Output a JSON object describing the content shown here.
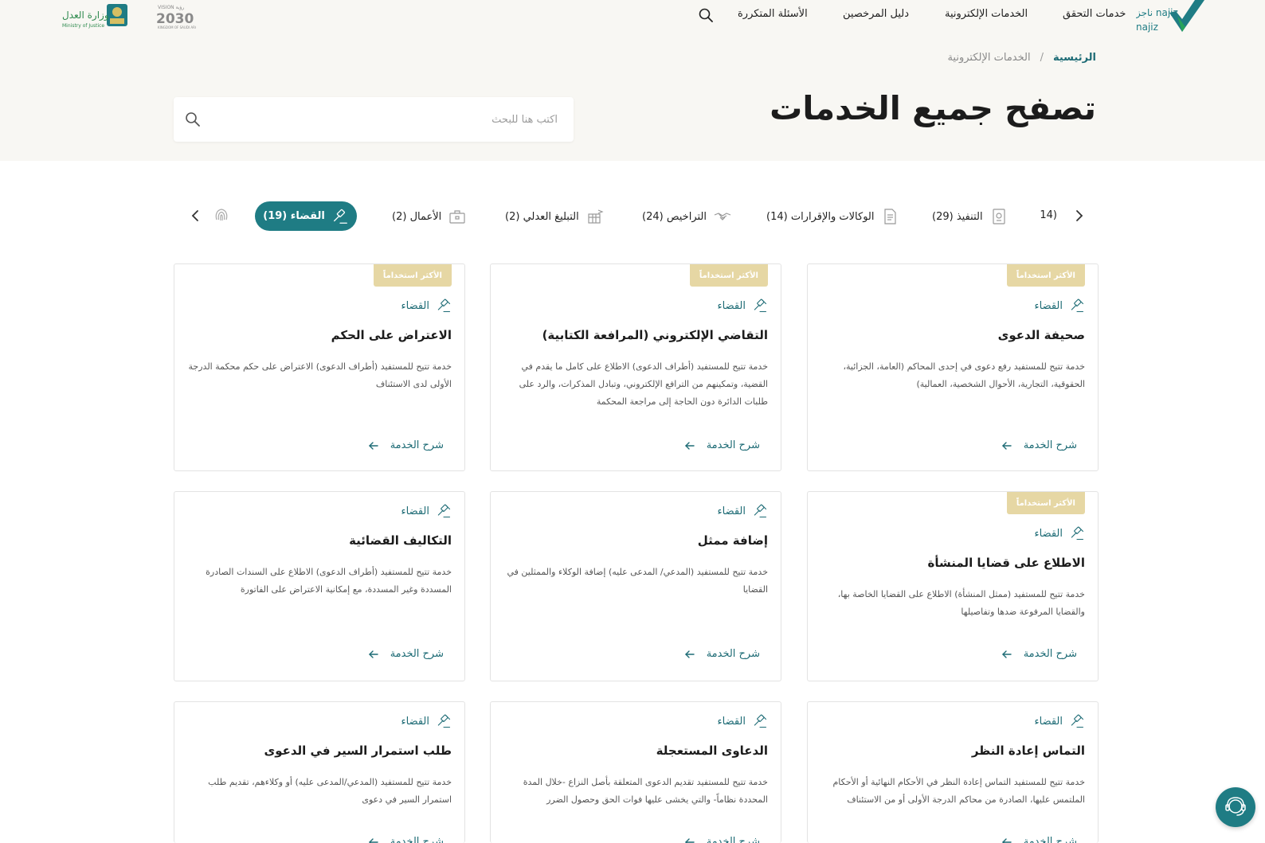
{
  "header": {
    "logo_text": "ناجز najiz",
    "nav": [
      "خدمات التحقق",
      "الخدمات الإلكترونية",
      "دليل المرخصين",
      "الأسئلة المتكررة"
    ],
    "search_icon": "search-icon",
    "vision_logo_text": "VISION 2030",
    "ministry_logo_text": "وزارة العدل Ministry of Justice"
  },
  "breadcrumb": {
    "home": "الرئيسية",
    "separator": "/",
    "current": "الخدمات الإلكترونية"
  },
  "page_title": "تصفح جميع الخدمات",
  "search": {
    "placeholder": "اكتب هنا للبحث",
    "value": ""
  },
  "categories": {
    "partial": "(14",
    "items": [
      {
        "label": "التنفيذ (29)",
        "icon": "execution-icon"
      },
      {
        "label": "الوكالات والإقرارات (14)",
        "icon": "document-icon"
      },
      {
        "label": "التراخيص (24)",
        "icon": "handshake-icon"
      },
      {
        "label": "التبليغ العدلي (2)",
        "icon": "notification-building-icon"
      },
      {
        "label": "الأعمال (2)",
        "icon": "briefcase-icon"
      }
    ],
    "active": {
      "label": "القضاء (19)",
      "icon": "gavel-icon"
    },
    "extra_icon": "fingerprint-icon"
  },
  "cards": [
    {
      "badge": "الأكثر استخداماً",
      "category": "القضاء",
      "title": "صحيفة الدعوى",
      "desc": "خدمة تتيح للمستفيد رفع دعوى في إحدى المحاكم (العامة، الجزائية، الحقوقية، التجارية، الأحوال الشخصية، العمالية)",
      "link": "شرح الخدمة"
    },
    {
      "badge": "الأكثر استخداماً",
      "category": "القضاء",
      "title": "التقاضي الإلكتروني (المرافعة الكتابية)",
      "desc": "خدمة تتيح للمستفيد (أطراف الدعوى) الاطلاع على كامل ما يقدم في القضية، وتمكينهم من الترافع الإلكتروني، وتبادل المذكرات، والرد على طلبات الدائرة دون الحاجة إلى مراجعة المحكمة",
      "link": "شرح الخدمة"
    },
    {
      "badge": "الأكثر استخداماً",
      "category": "القضاء",
      "title": "الاعتراض على الحكم",
      "desc": "خدمة تتيح للمستفيد (أطراف الدعوى) الاعتراض على حكم محكمة الدرجة الأولى لدى الاستئناف",
      "link": "شرح الخدمة"
    },
    {
      "badge": "الأكثر استخداماً",
      "category": "القضاء",
      "title": "الاطلاع على قضايا المنشأة",
      "desc": "خدمة تتيح للمستفيد (ممثل المنشأة) الاطلاع على القضايا الخاصة بها، والقضايا المرفوعة ضدها وتفاصيلها",
      "link": "شرح الخدمة"
    },
    {
      "badge": "",
      "category": "القضاء",
      "title": "إضافة ممثل",
      "desc": "خدمة تتيح للمستفيد (المدعي/ المدعى عليه) إضافة الوكلاء والممثلين في القضايا",
      "link": "شرح الخدمة"
    },
    {
      "badge": "",
      "category": "القضاء",
      "title": "التكاليف القضائية",
      "desc": "خدمة تتيح للمستفيد (أطراف الدعوى) الاطلاع على السندات الصادرة المسددة وغير المسددة، مع إمكانية الاعتراض على الفاتورة",
      "link": "شرح الخدمة"
    },
    {
      "badge": "",
      "category": "القضاء",
      "title": "التماس إعادة النظر",
      "desc": "خدمة تتيح للمستفيد التماس إعادة النظر في الأحكام النهائية أو الأحكام الملتمس عليها، الصادرة من محاكم الدرجة الأولى أو من الاستئناف",
      "link": "شرح الخدمة"
    },
    {
      "badge": "",
      "category": "القضاء",
      "title": "الدعاوى المستعجلة",
      "desc": "خدمة تتيح للمستفيد تقديم الدعوى المتعلقة بأصل النزاع -خلال المدة المحددة نظاماً- والتي يخشى عليها فوات الحق وحصول الضرر",
      "link": "شرح الخدمة"
    },
    {
      "badge": "",
      "category": "القضاء",
      "title": "طلب استمرار السير في الدعوى",
      "desc": "خدمة تتيح للمستفيد (المدعي/المدعى عليه) أو وكلاءهم، تقديم طلب استمرار السير في دعوى",
      "link": "شرح الخدمة"
    }
  ],
  "support_icon": "support-agent-icon",
  "colors": {
    "primary": "#1f7c84",
    "badge": "#e6d7a4",
    "hero_bg": "#f8f7f3"
  }
}
